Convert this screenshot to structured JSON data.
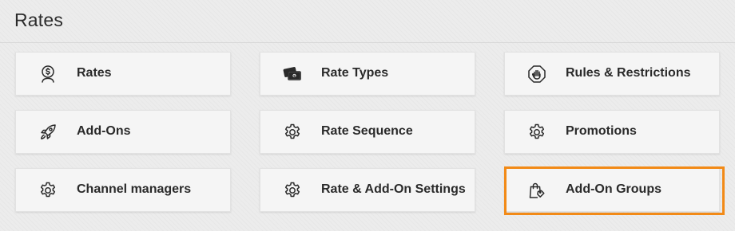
{
  "page": {
    "title": "Rates"
  },
  "tiles": [
    {
      "label": "Rates",
      "icon": "rates-dollar-person-icon"
    },
    {
      "label": "Rate Types",
      "icon": "money-stack-icon"
    },
    {
      "label": "Rules & Restrictions",
      "icon": "stop-hand-icon"
    },
    {
      "label": "Add-Ons",
      "icon": "rocket-icon"
    },
    {
      "label": "Rate Sequence",
      "icon": "gear-icon"
    },
    {
      "label": "Promotions",
      "icon": "gear-icon"
    },
    {
      "label": "Channel managers",
      "icon": "gear-icon"
    },
    {
      "label": "Rate & Add-On Settings",
      "icon": "gear-icon"
    },
    {
      "label": "Add-On Groups",
      "icon": "shopping-bag-tag-icon"
    }
  ],
  "highlighted_tile": "Add-On Groups",
  "colors": {
    "highlight_border": "#f28a17",
    "tile_background": "#f5f5f5",
    "page_background": "#ececec",
    "text": "#2a2a2a"
  }
}
